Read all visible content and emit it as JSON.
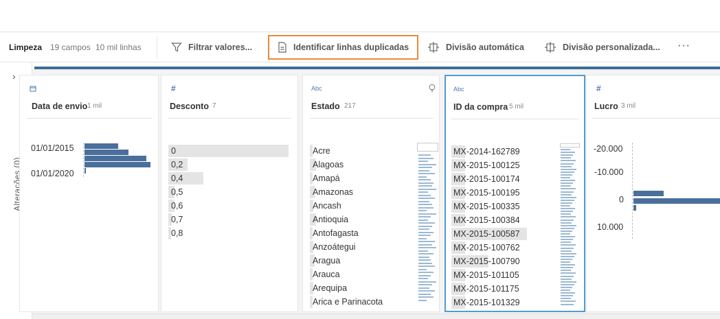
{
  "toolbar": {
    "step_name": "Limpeza",
    "fields": "19 campos",
    "rows": "10 mil linhas",
    "filter": "Filtrar valores...",
    "duplicates": "Identificar linhas duplicadas",
    "auto_split": "Divisão automática",
    "custom_split": "Divisão personalizada...",
    "more": "···"
  },
  "changes_panel": {
    "label": "Alterações (0)",
    "chevron": "›"
  },
  "colors": {
    "accent": "#3f6d98",
    "highlight": "#e88a3a",
    "selected": "#4f9bd3",
    "bar": "#4a6f9b"
  },
  "cards": {
    "ship_date": {
      "icon": "calendar-icon",
      "name": "Data de envio",
      "count": "1 mil",
      "labels": [
        "01/01/2015",
        "01/01/2020"
      ],
      "bars": [
        0.48,
        0.63,
        0.88,
        0.94,
        0.02
      ]
    },
    "discount": {
      "icon": "#",
      "name": "Desconto",
      "count": "7",
      "values": [
        "0",
        "0,2",
        "0,4",
        "0,5",
        "0,6",
        "0,7",
        "0,8"
      ],
      "bars": [
        1.0,
        0.16,
        0.29,
        0.05,
        0.05,
        0.03,
        0.02
      ]
    },
    "state": {
      "icon": "Abc",
      "name": "Estado",
      "count": "217",
      "values": [
        "Acre",
        "Alagoas",
        "Amapá",
        "Amazonas",
        "Ancash",
        "Antioquia",
        "Antofagasta",
        "Anzoátegui",
        "Aragua",
        "Arauca",
        "Arequipa",
        "Arica e Parinacota"
      ],
      "bars": [
        0.01,
        0.05,
        0.02,
        0.04,
        0.03,
        0.05,
        0.02,
        0.03,
        0.04,
        0.02,
        0.03,
        0.01
      ]
    },
    "order_id": {
      "icon": "Abc",
      "name": "ID da compra",
      "count": "5 mil",
      "values": [
        "MX-2014-162789",
        "MX-2015-100125",
        "MX-2015-100174",
        "MX-2015-100195",
        "MX-2015-100335",
        "MX-2015-100384",
        "MX-2015-100587",
        "MX-2015-100762",
        "MX-2015-100790",
        "MX-2015-101105",
        "MX-2015-101175",
        "MX-2015-101329"
      ],
      "bars": [
        0.18,
        0.18,
        0.18,
        0.18,
        0.18,
        0.18,
        0.98,
        0.18,
        0.48,
        0.18,
        0.18,
        0.18
      ]
    },
    "profit": {
      "icon": "#",
      "name": "Lucro",
      "count": "3 mil",
      "ticks": [
        "-20.000",
        "-10.000",
        "0",
        "10.000"
      ],
      "bars": [
        0.33,
        1.0,
        0.03
      ]
    }
  }
}
